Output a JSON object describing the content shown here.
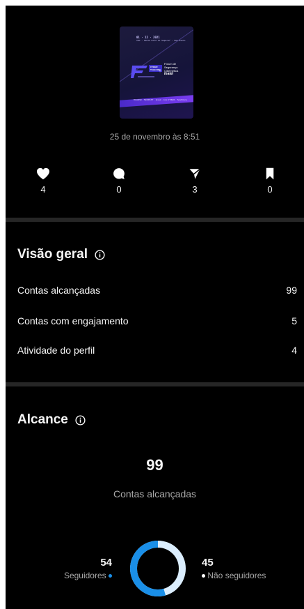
{
  "post": {
    "date": "25 de novembro às 8:51",
    "poster": {
      "meta_line1": "01 · 12 · 2021",
      "meta_line2": "16h · Santa Rita do Sapucaí · São Paulo",
      "event_logo": "CYBER TELECOM",
      "forum_line1": "Fórum de",
      "forum_line2": "Segurança",
      "forum_line3": "Cibernética",
      "forum_brand": "Inatel",
      "sponsors": "HUAWEI  · TEMPEST · Ipsam · ALL CYBER · Telefônica · ABRIS · nokia · ERICSSON"
    }
  },
  "stats": [
    {
      "icon": "heart-icon",
      "value": "4"
    },
    {
      "icon": "comment-icon",
      "value": "0"
    },
    {
      "icon": "share-icon",
      "value": "3"
    },
    {
      "icon": "bookmark-icon",
      "value": "0"
    }
  ],
  "overview": {
    "title": "Visão geral",
    "rows": [
      {
        "label": "Contas alcançadas",
        "value": "99"
      },
      {
        "label": "Contas com engajamento",
        "value": "5"
      },
      {
        "label": "Atividade do perfil",
        "value": "4"
      }
    ]
  },
  "reach": {
    "title": "Alcance",
    "total": "99",
    "total_label": "Contas alcançadas",
    "followers": {
      "value": "54",
      "label": "Seguidores",
      "color": "#1a8fe8"
    },
    "non_followers": {
      "value": "45",
      "label": "Não seguidores",
      "color": "#dbeefe"
    }
  },
  "colors": {
    "background": "#000000",
    "divider": "#262626",
    "muted_text": "#a8a8a8"
  }
}
